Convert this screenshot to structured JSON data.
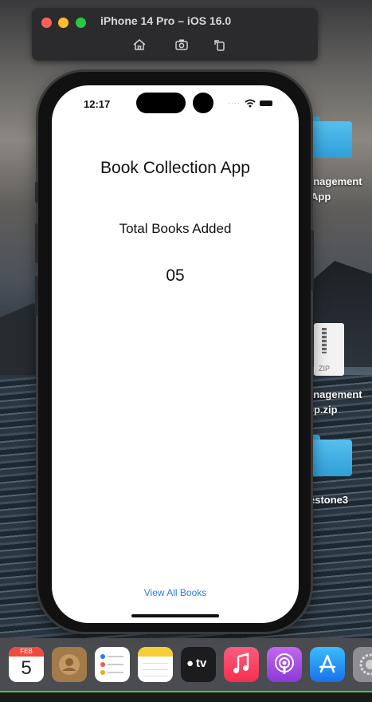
{
  "simulator": {
    "title": "iPhone 14 Pro – iOS 16.0",
    "buttons": [
      "home-icon",
      "screenshot-icon",
      "rotate-icon"
    ]
  },
  "desktop": {
    "items": [
      {
        "label_line1": "anagement",
        "label_line2": "App"
      },
      {
        "label_line1": "anagement",
        "label_line2": "pp.zip",
        "badge": "ZIP"
      },
      {
        "label_line1": "estone3"
      }
    ]
  },
  "status_bar": {
    "time": "12:17"
  },
  "app": {
    "title": "Book Collection App",
    "subtitle": "Total Books Added",
    "count": "05",
    "view_all_label": "View All Books"
  },
  "dock": {
    "calendar_month": "FEB",
    "calendar_day": "5",
    "tv_label": "tv",
    "icons": [
      "calendar-icon",
      "contacts-icon",
      "reminders-icon",
      "notes-icon",
      "apple-tv-icon",
      "music-icon",
      "podcasts-icon",
      "app-store-icon",
      "system-settings-icon"
    ]
  },
  "colors": {
    "link": "#2a7de1",
    "folder": "#3aa6dd",
    "close": "#ff5f57",
    "minimize": "#febc2e",
    "zoom": "#28c840"
  }
}
